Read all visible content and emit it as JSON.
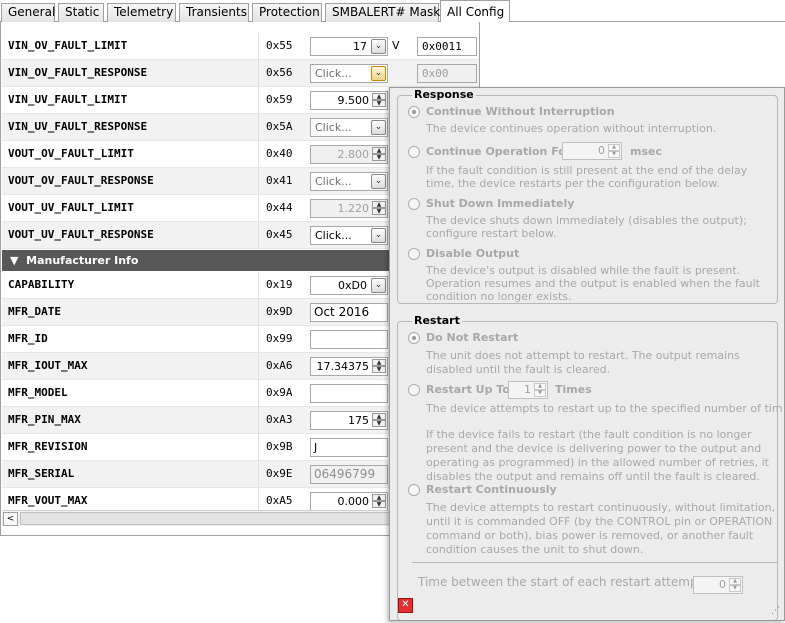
{
  "tabs": [
    "General",
    "Static",
    "Telemetry",
    "Transients",
    "Protection",
    "SMBALERT# Mask",
    "All Config"
  ],
  "rows_top": [
    {
      "name": "VIN_OV_FAULT_LIMIT",
      "code": "0x55",
      "value": "17",
      "unit": "V",
      "hex": "0x0011"
    },
    {
      "name": "VIN_OV_FAULT_RESPONSE",
      "code": "0x56",
      "value": "Click...",
      "hex": "0x00"
    },
    {
      "name": "VIN_UV_FAULT_LIMIT",
      "code": "0x59",
      "value": "9.500"
    },
    {
      "name": "VIN_UV_FAULT_RESPONSE",
      "code": "0x5A",
      "value": "Click..."
    },
    {
      "name": "VOUT_OV_FAULT_LIMIT",
      "code": "0x40",
      "value": "2.800"
    },
    {
      "name": "VOUT_OV_FAULT_RESPONSE",
      "code": "0x41",
      "value": "Click..."
    },
    {
      "name": "VOUT_UV_FAULT_LIMIT",
      "code": "0x44",
      "value": "1.220"
    },
    {
      "name": "VOUT_UV_FAULT_RESPONSE",
      "code": "0x45",
      "value": "Click..."
    }
  ],
  "group_header": "Manufacturer Info",
  "rows_mfr": [
    {
      "name": "CAPABILITY",
      "code": "0x19",
      "value": "0xD0"
    },
    {
      "name": "MFR_DATE",
      "code": "0x9D",
      "value": "Oct 2016"
    },
    {
      "name": "MFR_ID",
      "code": "0x99",
      "value": ""
    },
    {
      "name": "MFR_IOUT_MAX",
      "code": "0xA6",
      "value": "17.34375"
    },
    {
      "name": "MFR_MODEL",
      "code": "0x9A",
      "value": ""
    },
    {
      "name": "MFR_PIN_MAX",
      "code": "0xA3",
      "value": "175"
    },
    {
      "name": "MFR_REVISION",
      "code": "0x9B",
      "value": "J"
    },
    {
      "name": "MFR_SERIAL",
      "code": "0x9E",
      "value": "06496799"
    },
    {
      "name": "MFR_VOUT_MAX",
      "code": "0xA5",
      "value": "0.000"
    }
  ],
  "popup": {
    "response_title": "Response",
    "response_options": [
      {
        "label": "Continue Without Interruption",
        "desc": [
          "The device continues operation without interruption."
        ]
      },
      {
        "label": "Continue Operation For",
        "spin_value": "0",
        "spin_unit": "msec",
        "desc": [
          "If the fault condition is still present at the end of the delay",
          "time, the device restarts per the configuration below."
        ]
      },
      {
        "label": "Shut Down Immediately",
        "desc": [
          "The device shuts down immediately (disables the output);",
          "configure restart below."
        ]
      },
      {
        "label": "Disable Output",
        "desc": [
          "The device's output is disabled while the fault is present.",
          "Operation resumes and the output is enabled when the fault",
          "condition no longer exists."
        ]
      }
    ],
    "restart_title": "Restart",
    "restart_options": [
      {
        "label": "Do Not Restart",
        "desc": [
          "The unit does not attempt to restart. The output remains",
          "disabled until the fault is cleared."
        ]
      },
      {
        "label": "Restart Up To",
        "spin_value": "1",
        "spin_unit": "Times",
        "desc": [
          "The device attempts to restart up to the specified number of tim",
          "",
          "If the device fails to restart (the fault condition is no longer",
          "present and the device is delivering power to the output and",
          "operating as programmed) in the allowed number of retries, it",
          "disables the output and remains off until the fault is cleared."
        ]
      },
      {
        "label": "Restart Continuously",
        "desc": [
          "The device attempts to restart continuously, without limitation,",
          "until it is commanded OFF (by the CONTROL pin or OPERATION",
          "command or both), bias power is removed, or another fault",
          "condition causes the unit to shut down."
        ]
      }
    ],
    "restart_time_label": "Time between the start of each restart attempt:",
    "restart_time_value": "0"
  }
}
